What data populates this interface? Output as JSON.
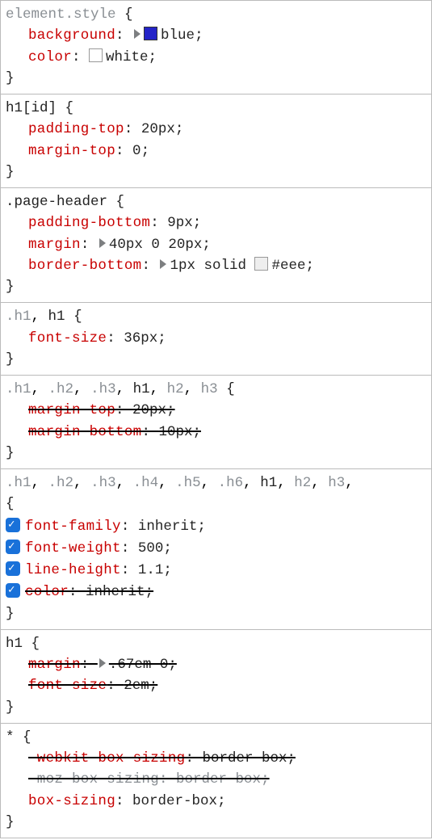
{
  "rules": [
    {
      "selectors": [
        {
          "t": "element.style",
          "dim": true
        }
      ],
      "decls": [
        {
          "prop": "background",
          "valParts": [
            {
              "tri": true
            },
            {
              "swatch": "#2424c8"
            },
            {
              "txt": "blue"
            }
          ],
          "semi": true
        },
        {
          "prop": "color",
          "valParts": [
            {
              "swatch": "#ffffff",
              "border": true
            },
            {
              "txt": "white"
            }
          ],
          "semi": true
        }
      ]
    },
    {
      "selectors": [
        {
          "t": "h1[id]",
          "dim": false
        }
      ],
      "decls": [
        {
          "prop": "padding-top",
          "valParts": [
            {
              "txt": "20px"
            }
          ],
          "semi": true
        },
        {
          "prop": "margin-top",
          "valParts": [
            {
              "txt": "0"
            }
          ],
          "semi": true
        }
      ]
    },
    {
      "selectors": [
        {
          "t": ".page-header",
          "dim": false
        }
      ],
      "decls": [
        {
          "prop": "padding-bottom",
          "valParts": [
            {
              "txt": "9px"
            }
          ],
          "semi": true
        },
        {
          "prop": "margin",
          "valParts": [
            {
              "tri": true
            },
            {
              "txt": "40px 0 20px"
            }
          ],
          "semi": true
        },
        {
          "prop": "border-bottom",
          "valParts": [
            {
              "tri": true
            },
            {
              "txt": "1px solid "
            },
            {
              "swatch": "#eeeeee",
              "border": true
            },
            {
              "txt": "#eee"
            }
          ],
          "semi": true
        }
      ]
    },
    {
      "selectors": [
        {
          "t": ".h1",
          "dim": true
        },
        {
          "t": ", ",
          "raw": true
        },
        {
          "t": "h1",
          "dim": false
        }
      ],
      "decls": [
        {
          "prop": "font-size",
          "valParts": [
            {
              "txt": "36px"
            }
          ],
          "semi": true
        }
      ]
    },
    {
      "selectors": [
        {
          "t": ".h1",
          "dim": true
        },
        {
          "raw": true,
          "t": ", "
        },
        {
          "t": ".h2",
          "dim": true
        },
        {
          "raw": true,
          "t": ", "
        },
        {
          "t": ".h3",
          "dim": true
        },
        {
          "raw": true,
          "t": ", "
        },
        {
          "t": "h1",
          "dim": false
        },
        {
          "raw": true,
          "t": ", "
        },
        {
          "t": "h2",
          "dim": true
        },
        {
          "raw": true,
          "t": ", "
        },
        {
          "t": "h3",
          "dim": true
        }
      ],
      "decls": [
        {
          "prop": "margin-top",
          "valParts": [
            {
              "txt": "20px"
            }
          ],
          "strike": true,
          "semi": true
        },
        {
          "prop": "margin-bottom",
          "valParts": [
            {
              "txt": "10px"
            }
          ],
          "strike": true,
          "semi": true
        }
      ]
    },
    {
      "selectors": [
        {
          "t": ".h1",
          "dim": true
        },
        {
          "raw": true,
          "t": ", "
        },
        {
          "t": ".h2",
          "dim": true
        },
        {
          "raw": true,
          "t": ", "
        },
        {
          "t": ".h3",
          "dim": true
        },
        {
          "raw": true,
          "t": ", "
        },
        {
          "t": ".h4",
          "dim": true
        },
        {
          "raw": true,
          "t": ", "
        },
        {
          "t": ".h5",
          "dim": true
        },
        {
          "raw": true,
          "t": ", "
        },
        {
          "t": ".h6",
          "dim": true
        },
        {
          "raw": true,
          "t": ", "
        },
        {
          "t": "h1",
          "dim": false
        },
        {
          "raw": true,
          "t": ", "
        },
        {
          "t": "h2",
          "dim": true
        },
        {
          "raw": true,
          "t": ", "
        },
        {
          "t": "h3",
          "dim": true
        },
        {
          "raw": true,
          "t": ","
        }
      ],
      "braceOnNewLine": true,
      "decls": [
        {
          "prop": "font-family",
          "valParts": [
            {
              "txt": "inherit"
            }
          ],
          "checked": true,
          "semi": true
        },
        {
          "prop": "font-weight",
          "valParts": [
            {
              "txt": "500"
            }
          ],
          "checked": true,
          "semi": true
        },
        {
          "prop": "line-height",
          "valParts": [
            {
              "txt": "1.1"
            }
          ],
          "checked": true,
          "semi": true
        },
        {
          "prop": "color",
          "valParts": [
            {
              "txt": "inherit"
            }
          ],
          "checked": true,
          "strike": true,
          "semi": true
        }
      ]
    },
    {
      "selectors": [
        {
          "t": "h1",
          "dim": false
        }
      ],
      "decls": [
        {
          "prop": "margin",
          "valParts": [
            {
              "tri": true
            },
            {
              "txt": ".67em 0"
            }
          ],
          "strike": true,
          "semi": true
        },
        {
          "prop": "font-size",
          "valParts": [
            {
              "txt": "2em"
            }
          ],
          "strike": true,
          "semi": true
        }
      ]
    },
    {
      "selectors": [
        {
          "t": "*",
          "dim": false
        }
      ],
      "decls": [
        {
          "prop": "-webkit-box-sizing",
          "valParts": [
            {
              "txt": "border-box"
            }
          ],
          "strike": true,
          "semi": true
        },
        {
          "prop": "-moz-box-sizing",
          "valParts": [
            {
              "txt": "border-box"
            }
          ],
          "strike": true,
          "dimgray": true,
          "semi": true
        },
        {
          "prop": "box-sizing",
          "valParts": [
            {
              "txt": "border-box"
            }
          ],
          "semi": true
        }
      ]
    }
  ]
}
